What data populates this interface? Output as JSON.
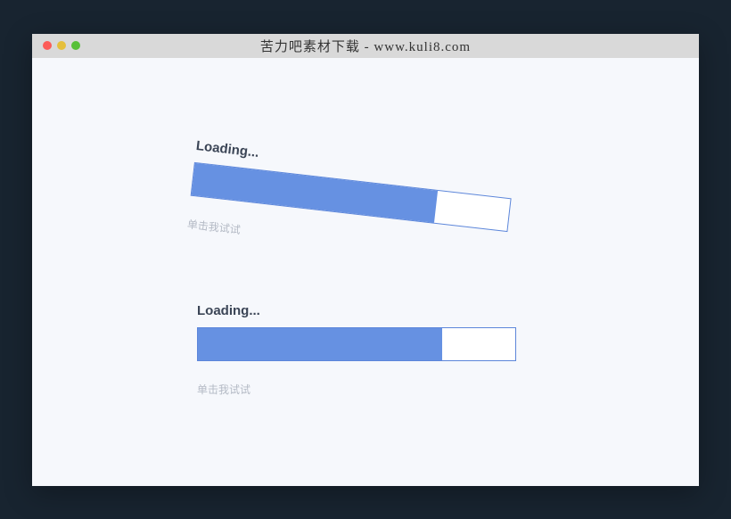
{
  "window": {
    "title": "苦力吧素材下载 - www.kuli8.com"
  },
  "loader1": {
    "label": "Loading...",
    "hint": "单击我试试"
  },
  "loader2": {
    "label": "Loading...",
    "hint": "单击我试试"
  }
}
